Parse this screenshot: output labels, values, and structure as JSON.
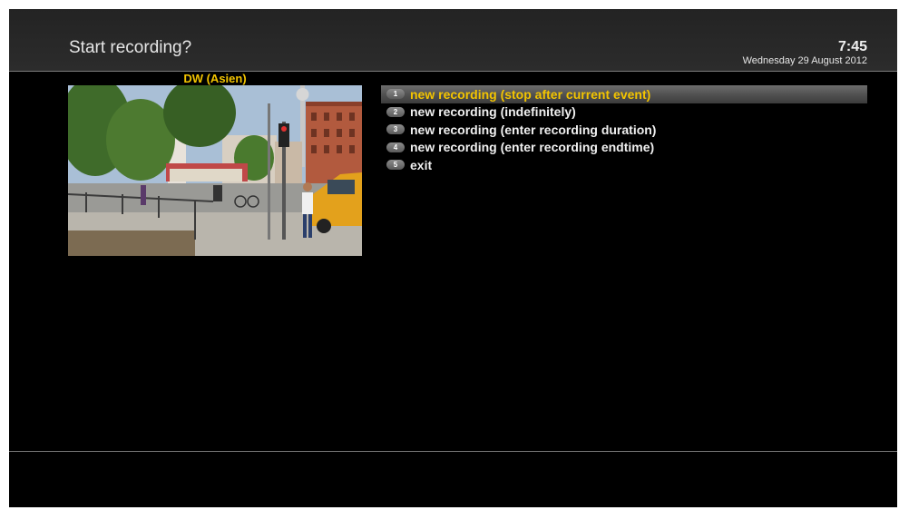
{
  "header": {
    "title": "Start recording?",
    "clock": "7:45",
    "date": "Wednesday 29 August 2012"
  },
  "preview": {
    "channel_name": "DW (Asien)"
  },
  "menu": {
    "selected_index": 0,
    "items": [
      {
        "number": "1",
        "label": "new recording (stop after current event)"
      },
      {
        "number": "2",
        "label": "new recording (indefinitely)"
      },
      {
        "number": "3",
        "label": "new recording (enter recording duration)"
      },
      {
        "number": "4",
        "label": "new recording (enter recording endtime)"
      },
      {
        "number": "5",
        "label": "exit"
      }
    ]
  },
  "colors": {
    "accent": "#f3c400",
    "background": "#000000",
    "header": "#2a2a2a",
    "text": "#f0f0f0"
  }
}
